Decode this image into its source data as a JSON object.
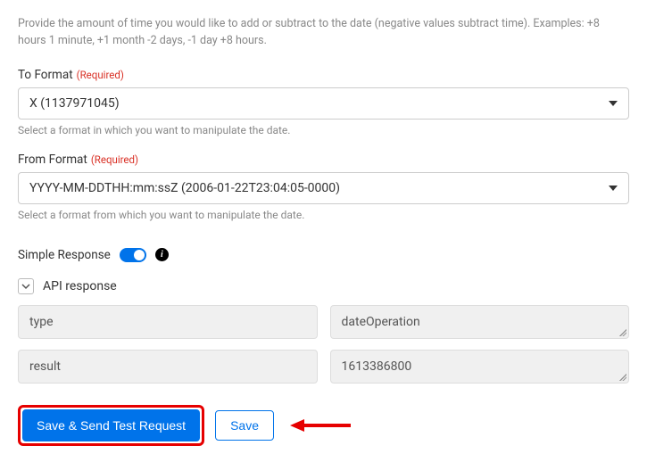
{
  "intro_help": "Provide the amount of time you would like to add or subtract to the date (negative values subtract time). Examples: +8 hours 1 minute, +1 month -2 days, -1 day +8 hours.",
  "required_text": "(Required)",
  "to_format": {
    "label": "To Format",
    "value": "X (1137971045)",
    "help": "Select a format in which you want to manipulate the date."
  },
  "from_format": {
    "label": "From Format",
    "value": "YYYY-MM-DDTHH:mm:ssZ (2006-01-22T23:04:05-0000)",
    "help": "Select a format from which you want to manipulate the date."
  },
  "simple_response": {
    "label": "Simple Response",
    "enabled": true
  },
  "api_response": {
    "label": "API response",
    "rows": [
      {
        "key": "type",
        "value": "dateOperation"
      },
      {
        "key": "result",
        "value": "1613386800"
      }
    ]
  },
  "buttons": {
    "primary": "Save & Send Test Request",
    "secondary": "Save"
  }
}
